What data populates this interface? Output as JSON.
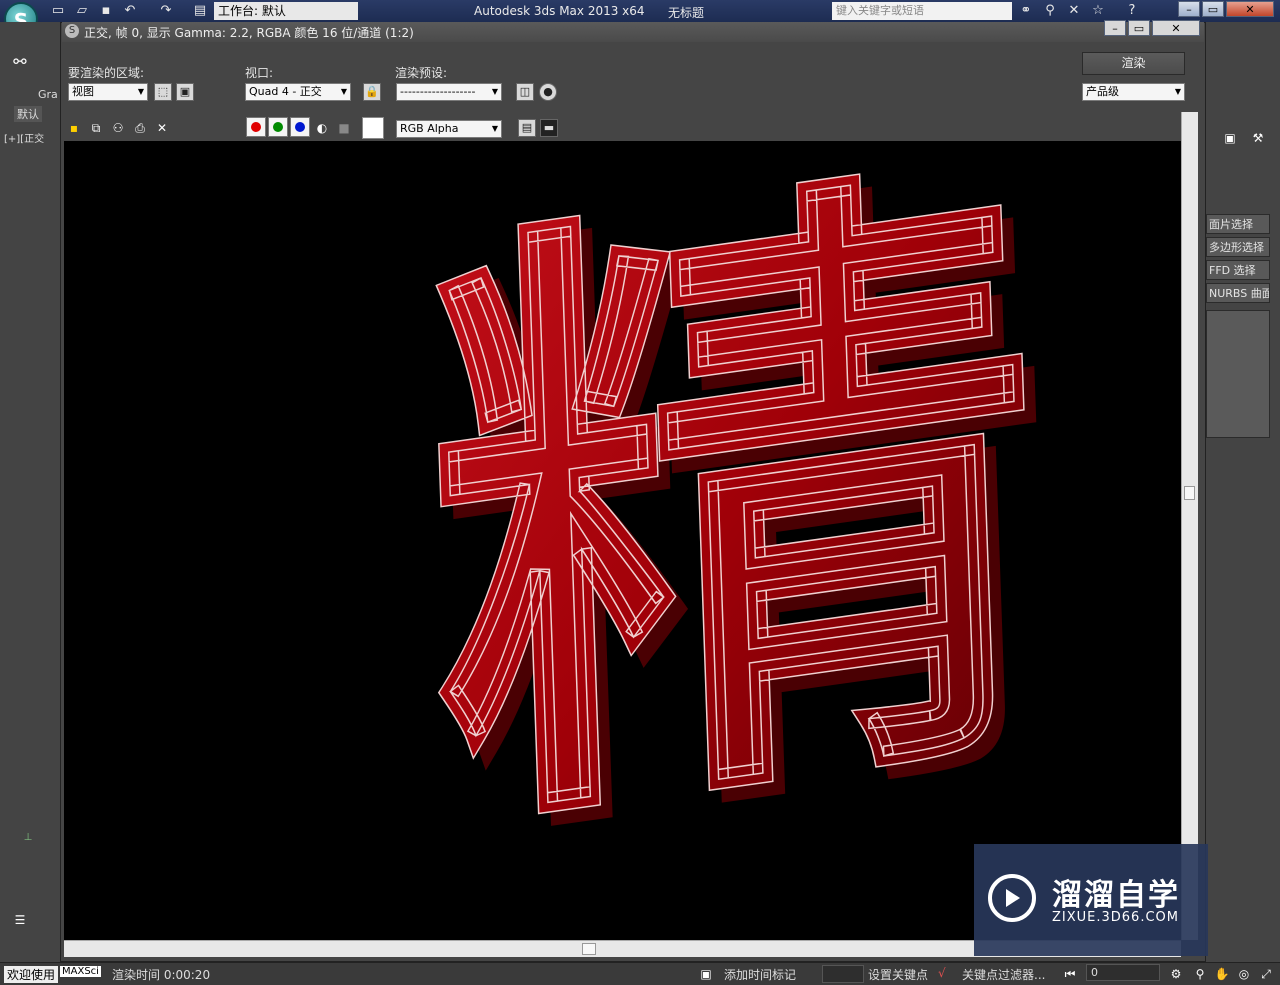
{
  "app": {
    "logo": "3ds-max-logo",
    "workspace": "工作台: 默认",
    "title": "Autodesk 3ds Max  2013 x64",
    "document": "无标题",
    "search_placeholder": "键入关键字或短语"
  },
  "left_panel": {
    "tab_partial": "Gra",
    "default_tab": "默认",
    "viewport_label": "[+][正交"
  },
  "right_panel": {
    "items": [
      "面片选择",
      "多边形选择",
      "FFD 选择",
      "NURBS 曲面选择"
    ]
  },
  "frame_window": {
    "title": "正交, 帧 0, 显示 Gamma: 2.2, RGBA 颜色 16 位/通道 (1:2)",
    "area_label": "要渲染的区域:",
    "area_value": "视图",
    "viewport_label": "视口:",
    "viewport_value": "Quad 4 - 正交",
    "preset_label": "渲染预设:",
    "preset_value": "-------------------",
    "render_button": "渲染",
    "quality_value": "产品级",
    "channel_value": "RGB Alpha"
  },
  "render": {
    "character": "精",
    "color": "#a30006"
  },
  "watermark": {
    "title": "溜溜自学",
    "url": "ZIXUE.3D66.COM"
  },
  "status": {
    "welcome": "欢迎使用",
    "maxscript": "MAXSci",
    "render_time": "渲染时间 0:00:20",
    "add_time_tag": "添加时间标记",
    "set_key": "设置关键点",
    "key_filters": "关键点过滤器...",
    "frame_value": "0"
  }
}
